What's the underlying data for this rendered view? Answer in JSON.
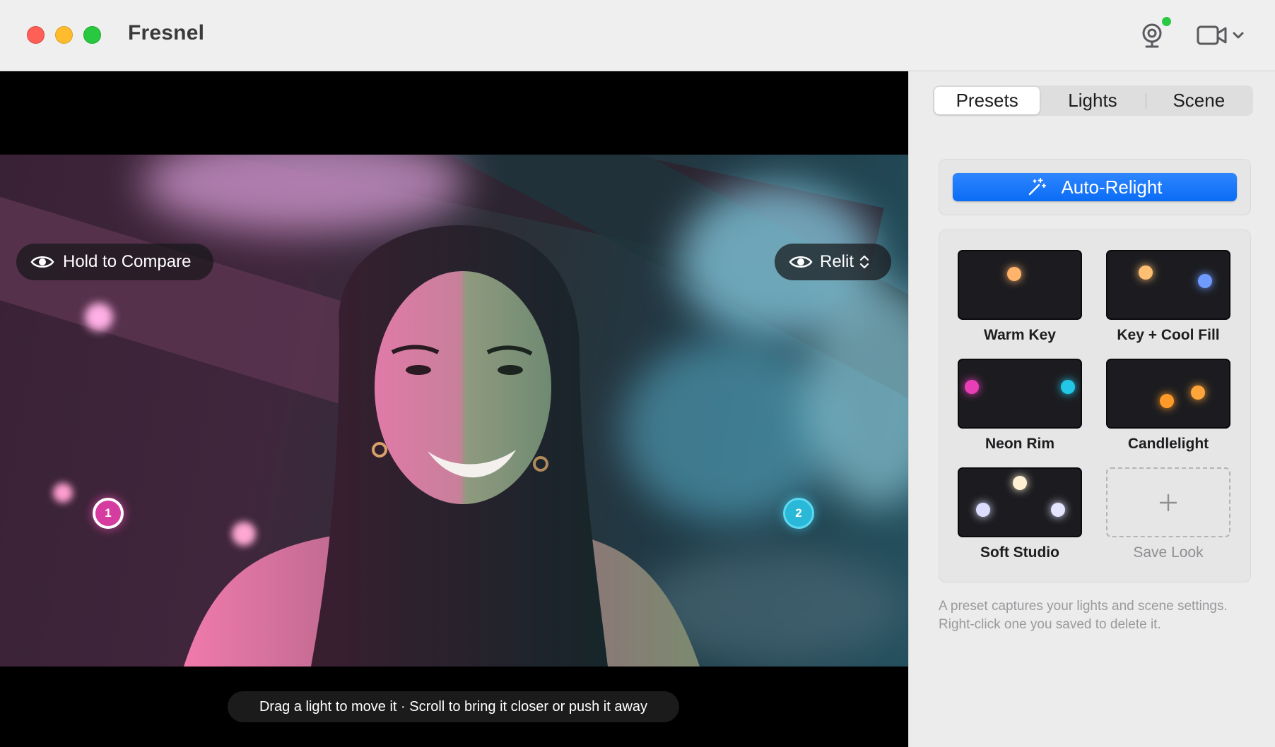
{
  "app": {
    "title": "Fresnel"
  },
  "titlebar": {
    "webcam_icon": "webcam-icon",
    "webcam_status_color": "#2ac845",
    "camera_icon": "video-camera-icon",
    "camera_menu_icon": "chevron-down-icon"
  },
  "viewer": {
    "compare_label": "Hold to Compare",
    "compare_icon": "eye-icon",
    "view_mode": "Relit",
    "view_mode_icon": "eye-icon",
    "lights": [
      {
        "number": "1",
        "color": "#d63b9f"
      },
      {
        "number": "2",
        "color": "#2ab8d8"
      }
    ],
    "hint": "Drag a light to move it · Scroll to bring it closer or push it away"
  },
  "sidebar": {
    "tabs": [
      {
        "label": "Presets",
        "active": true
      },
      {
        "label": "Lights",
        "active": false
      },
      {
        "label": "Scene",
        "active": false
      }
    ],
    "auto_relight": {
      "label": "Auto-Relight",
      "icon": "magic-wand-icon",
      "color": "#0a6cf5"
    },
    "presets": [
      {
        "name": "Warm Key",
        "dot_colors": [
          "#ffb36b"
        ]
      },
      {
        "name": "Key + Cool Fill",
        "dot_colors": [
          "#ffbf73",
          "#6f9bff"
        ]
      },
      {
        "name": "Neon Rim",
        "dot_colors": [
          "#e83fb7",
          "#22c7e8"
        ]
      },
      {
        "name": "Candlelight",
        "dot_colors": [
          "#ff9a2a",
          "#ffa53a"
        ]
      },
      {
        "name": "Soft Studio",
        "dot_colors": [
          "#fff0d4",
          "#dcdcff",
          "#e4e4ff"
        ]
      }
    ],
    "save_look": {
      "label": "Save Look",
      "icon": "plus-icon"
    },
    "note": "A preset captures your lights and scene settings. Right-click one you saved to delete it."
  }
}
